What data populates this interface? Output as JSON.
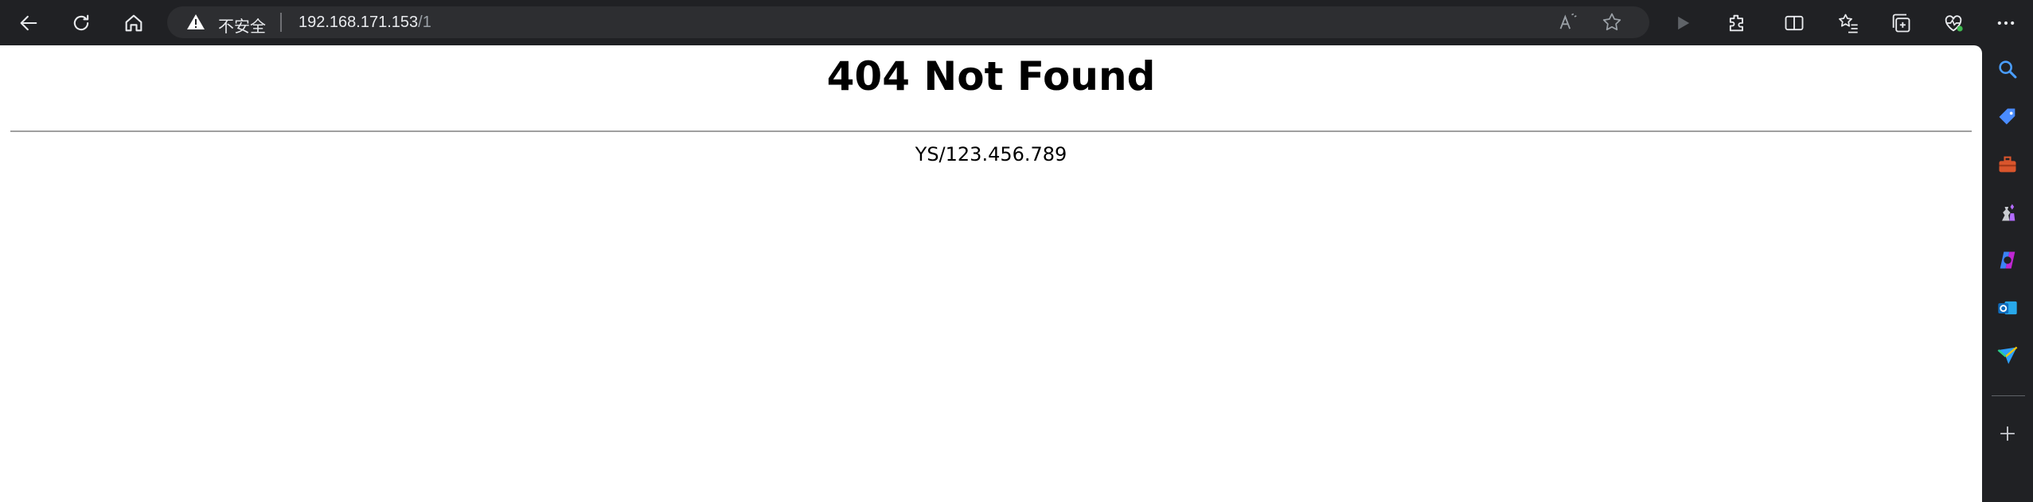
{
  "browser": {
    "address_bar": {
      "security_label": "不安全",
      "url_host": "192.168.171.153",
      "url_path": "/1"
    }
  },
  "page": {
    "heading": "404 Not Found",
    "server_signature": "YS/123.456.789"
  },
  "icons": {
    "toolbar": [
      "back-icon",
      "refresh-icon",
      "home-icon",
      "read-aloud-icon",
      "favorite-star-icon",
      "play-icon",
      "extensions-icon",
      "split-screen-icon",
      "favorites-list-icon",
      "collections-icon",
      "browser-essentials-icon",
      "more-icon"
    ],
    "sidebar": [
      "search-icon",
      "shopping-tag-icon",
      "tools-icon",
      "games-icon",
      "copilot-icon",
      "outlook-icon",
      "drop-icon",
      "add-icon"
    ]
  },
  "colors": {
    "chrome_bg": "#202124",
    "address_bg": "#2d2e31",
    "page_bg": "#ffffff"
  }
}
